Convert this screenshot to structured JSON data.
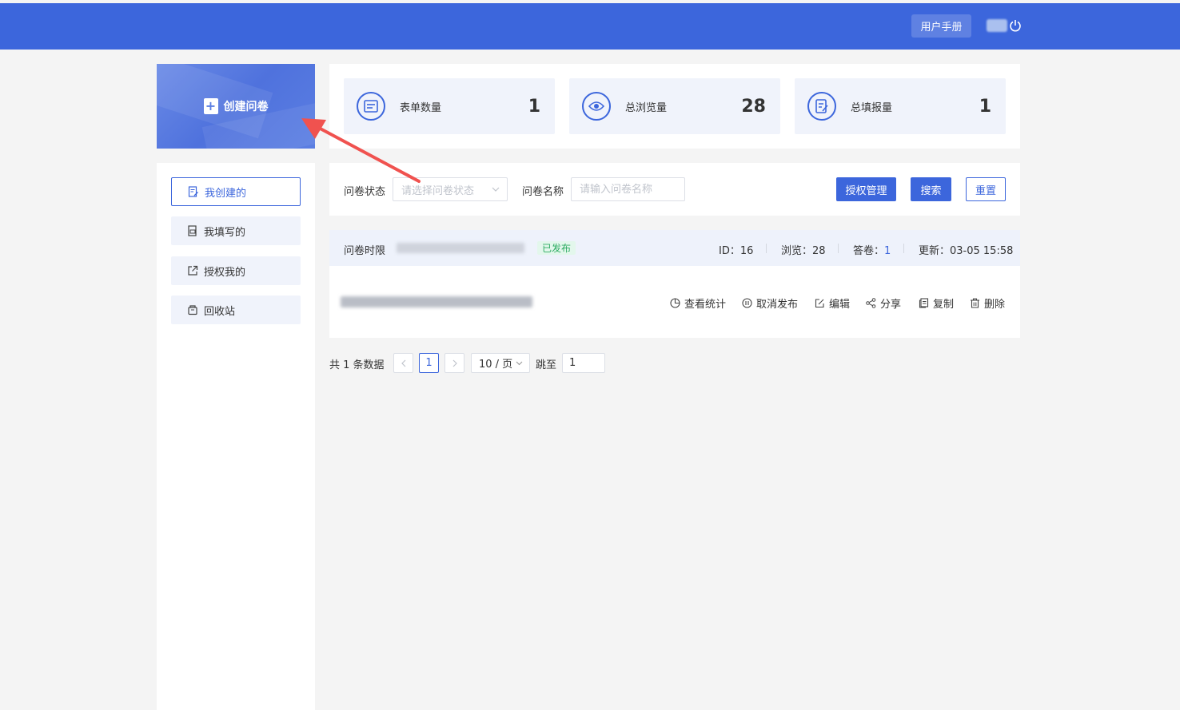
{
  "header": {
    "manual_label": "用户手册",
    "icons": {
      "power": "power-icon"
    }
  },
  "create": {
    "label": "创建问卷",
    "icon": "plus-document-icon"
  },
  "sidebar": {
    "items": [
      {
        "label": "我创建的",
        "icon": "edit-doc-icon",
        "active": true
      },
      {
        "label": "我填写的",
        "icon": "filled-doc-icon",
        "active": false
      },
      {
        "label": "授权我的",
        "icon": "external-link-icon",
        "active": false
      },
      {
        "label": "回收站",
        "icon": "recycle-icon",
        "active": false
      }
    ]
  },
  "stats": [
    {
      "label": "表单数量",
      "value": "1",
      "icon": "form-icon"
    },
    {
      "label": "总浏览量",
      "value": "28",
      "icon": "eye-icon"
    },
    {
      "label": "总填报量",
      "value": "1",
      "icon": "report-icon"
    }
  ],
  "filter": {
    "status_label": "问卷状态",
    "status_placeholder": "请选择问卷状态",
    "name_label": "问卷名称",
    "name_placeholder": "请输入问卷名称",
    "auth_btn": "授权管理",
    "search_btn": "搜索",
    "reset_btn": "重置"
  },
  "survey": {
    "time_label": "问卷时限",
    "status": "已发布",
    "id_text": "ID：16",
    "views_text": "浏览：28",
    "answers_label": "答卷：",
    "answers_value": "1",
    "updated_text": "更新：03-05 15:58",
    "actions": [
      {
        "label": "查看统计",
        "icon": "pie-chart-icon"
      },
      {
        "label": "取消发布",
        "icon": "pause-circle-icon"
      },
      {
        "label": "编辑",
        "icon": "edit-icon"
      },
      {
        "label": "分享",
        "icon": "share-icon"
      },
      {
        "label": "复制",
        "icon": "copy-icon"
      },
      {
        "label": "删除",
        "icon": "trash-icon"
      }
    ]
  },
  "pagination": {
    "total_text": "共 1 条数据",
    "current_page": "1",
    "page_size": "10 / 页",
    "jump_label": "跳至",
    "jump_value": "1"
  },
  "colors": {
    "primary": "#3c66dc",
    "published": "#2dab62",
    "annotation_arrow": "#f0524f"
  }
}
